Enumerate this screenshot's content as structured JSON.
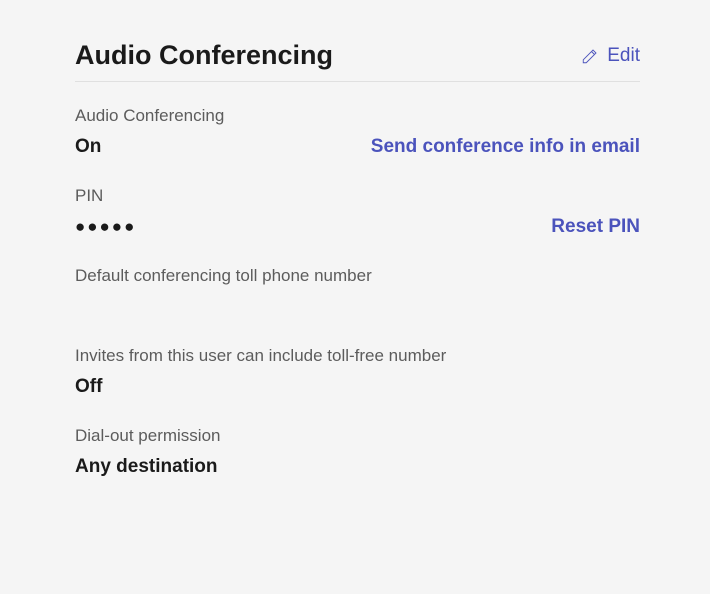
{
  "header": {
    "title": "Audio Conferencing",
    "edit_label": "Edit"
  },
  "fields": {
    "audio_conf": {
      "label": "Audio Conferencing",
      "value": "On",
      "action": "Send conference info in email"
    },
    "pin": {
      "label": "PIN",
      "value": "●●●●●",
      "action": "Reset PIN"
    },
    "toll_number": {
      "label": "Default conferencing toll phone number",
      "value": ""
    },
    "toll_free": {
      "label": "Invites from this user can include toll-free number",
      "value": "Off"
    },
    "dial_out": {
      "label": "Dial-out permission",
      "value": "Any destination"
    }
  }
}
